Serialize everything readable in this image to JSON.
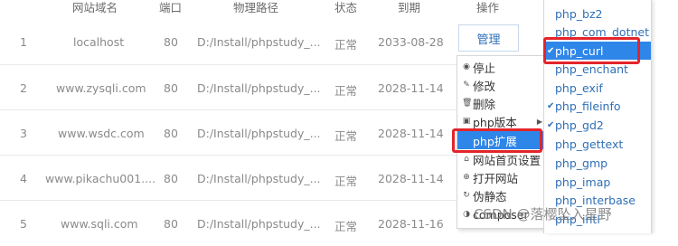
{
  "header": {
    "domain": "网站域名",
    "port": "端口",
    "path": "物理路径",
    "status": "状态",
    "expiry": "到期",
    "action": "操作"
  },
  "rows": [
    {
      "index": "1",
      "domain": "localhost",
      "port": "80",
      "path": "D:/Install/phpstudy_...",
      "status": "正常",
      "expiry": "2033-08-28"
    },
    {
      "index": "2",
      "domain": "www.zysqli.com",
      "port": "80",
      "path": "D:/Install/phpstudy_...",
      "status": "正常",
      "expiry": "2028-11-14"
    },
    {
      "index": "3",
      "domain": "www.wsdc.com",
      "port": "80",
      "path": "D:/Install/phpstudy_...",
      "status": "正常",
      "expiry": "2028-11-14"
    },
    {
      "index": "4",
      "domain": "www.pikachu001....",
      "port": "80",
      "path": "D:/Install/phpstudy_...",
      "status": "正常",
      "expiry": "2028-11-14"
    },
    {
      "index": "5",
      "domain": "www.sqli.com",
      "port": "80",
      "path": "D:/Install/phpstudy_...",
      "status": "正常",
      "expiry": "2028-11-16"
    }
  ],
  "manage_label": "管理",
  "context_menu": [
    {
      "icon": "stop-icon",
      "glyph": "◉",
      "label": "停止"
    },
    {
      "icon": "edit-icon",
      "glyph": "✎",
      "label": "修改"
    },
    {
      "icon": "trash-icon",
      "glyph": "🗑",
      "label": "删除"
    },
    {
      "icon": "php-version-icon",
      "glyph": "▣",
      "label": "php版本"
    },
    {
      "icon": "php-extension-icon",
      "glyph": "",
      "label": "php扩展"
    },
    {
      "icon": "home-icon",
      "glyph": "⌂",
      "label": "网站首页设置"
    },
    {
      "icon": "globe-icon",
      "glyph": "⊕",
      "label": "打开网站"
    },
    {
      "icon": "rewrite-icon",
      "glyph": "↻",
      "label": "伪静态"
    },
    {
      "icon": "composer-icon",
      "glyph": "◑",
      "label": "composer"
    }
  ],
  "submenu": [
    {
      "label": "php_bz2",
      "checked": false
    },
    {
      "label": "php_com_dotnet",
      "checked": false
    },
    {
      "label": "php_curl",
      "checked": true
    },
    {
      "label": "php_enchant",
      "checked": false
    },
    {
      "label": "php_exif",
      "checked": false
    },
    {
      "label": "php_fileinfo",
      "checked": true
    },
    {
      "label": "php_gd2",
      "checked": true
    },
    {
      "label": "php_gettext",
      "checked": false
    },
    {
      "label": "php_gmp",
      "checked": false
    },
    {
      "label": "php_imap",
      "checked": false
    },
    {
      "label": "php_interbase",
      "checked": false
    },
    {
      "label": "php_intl",
      "checked": false
    }
  ],
  "check_glyph": "✔",
  "watermark": "CSDN @落樱坠入星野",
  "colors": {
    "accent": "#2f86e9",
    "highlight": "#e3242b",
    "link": "#2f6fb7"
  }
}
